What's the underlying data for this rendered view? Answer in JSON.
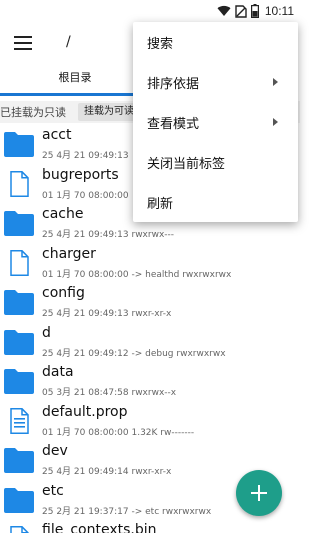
{
  "status_bar": {
    "time": "10:11",
    "battery_level": "half"
  },
  "toolbar": {
    "path": "/"
  },
  "tabs": [
    {
      "label": "根目录"
    }
  ],
  "mount": {
    "label": "已挂载为只读",
    "button": "挂载为可读"
  },
  "files": [
    {
      "name": "acct",
      "meta": "25 4月 21 09:49:13",
      "type": "folder"
    },
    {
      "name": "bugreports",
      "meta": "01 1月 70 08:00:00",
      "type": "file"
    },
    {
      "name": "cache",
      "meta": "25 4月 21 09:49:13   rwxrwx---",
      "type": "folder"
    },
    {
      "name": "charger",
      "meta": "01 1月 70 08:00:00   -> healthd  rwxrwxrwx",
      "type": "file"
    },
    {
      "name": "config",
      "meta": "25 4月 21 09:49:13   rwxr-xr-x",
      "type": "folder"
    },
    {
      "name": "d",
      "meta": "25 4月 21 09:49:12   -> debug  rwxrwxrwx",
      "type": "folder"
    },
    {
      "name": "data",
      "meta": "05 3月 21 08:47:58   rwxrwx--x",
      "type": "folder"
    },
    {
      "name": "default.prop",
      "meta": "01 1月 70 08:00:00   1.32K  rw-------",
      "type": "doc"
    },
    {
      "name": "dev",
      "meta": "25 4月 21 09:49:14   rwxr-xr-x",
      "type": "folder"
    },
    {
      "name": "etc",
      "meta": "25 2月 21 19:37:17   -> etc  rwxrwxrwx",
      "type": "folder"
    },
    {
      "name": "file_contexts.bin",
      "meta": "",
      "type": "file"
    }
  ],
  "menu": {
    "items": [
      {
        "label": "搜索",
        "submenu": false
      },
      {
        "label": "排序依据",
        "submenu": true
      },
      {
        "label": "查看模式",
        "submenu": true
      },
      {
        "label": "关闭当前标签",
        "submenu": false
      },
      {
        "label": "刷新",
        "submenu": false
      }
    ]
  },
  "fab": {
    "icon": "plus-icon"
  },
  "colors": {
    "accent": "#1976d2",
    "folder": "#1e88e5",
    "fab": "#1e9e8a",
    "mount_bar": "#f2f2f2"
  }
}
